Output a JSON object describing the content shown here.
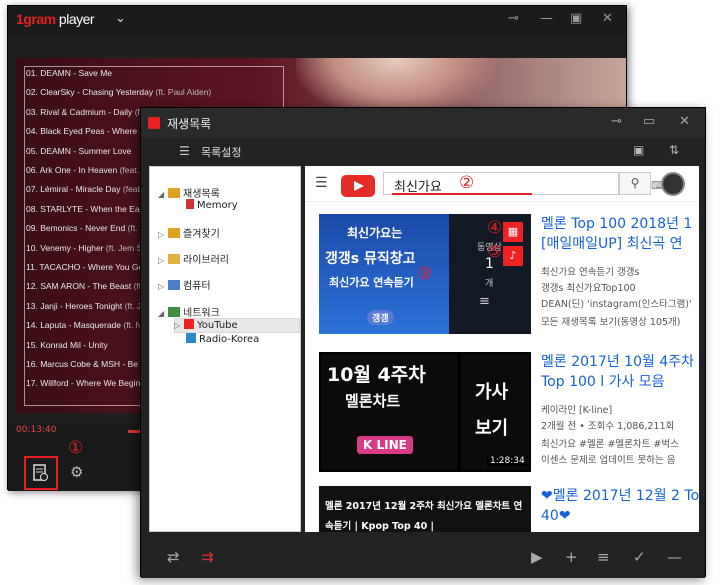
{
  "player": {
    "logo_brand": "1gram",
    "logo_word": "player",
    "time": "00:13:40",
    "tracks": [
      {
        "num": "01.",
        "title": "DEAMN - Save Me",
        "sub": ""
      },
      {
        "num": "02.",
        "title": "ClearSky - Chasing Yesterday",
        "sub": "(ft. Paul Aiden)"
      },
      {
        "num": "03.",
        "title": "Rival & Cadmium - Daily",
        "sub": "(ft. Ja"
      },
      {
        "num": "04.",
        "title": "Black Eyed Peas - Where Is T",
        "sub": ""
      },
      {
        "num": "05.",
        "title": "DEAMN - Summer Love",
        "sub": ""
      },
      {
        "num": "06.",
        "title": "Ark One - In Heaven",
        "sub": "(feat. Y"
      },
      {
        "num": "07.",
        "title": "Lémiral - Miracle Day",
        "sub": "(feat. U"
      },
      {
        "num": "08.",
        "title": "STARLYTE - When the Earth G",
        "sub": ""
      },
      {
        "num": "09.",
        "title": "Bemonics - Never End",
        "sub": "(ft. Ben"
      },
      {
        "num": "10.",
        "title": "Venemy - Higher",
        "sub": "(ft. Jem Str"
      },
      {
        "num": "11.",
        "title": "TACACHO - Where You Go",
        "sub": "(f"
      },
      {
        "num": "12.",
        "title": "SAM ARON - The Beast",
        "sub": "(ft. A"
      },
      {
        "num": "13.",
        "title": "Janji - Heroes Tonight",
        "sub": "(ft. John"
      },
      {
        "num": "14.",
        "title": "Laputa - Masquerade",
        "sub": "(ft. N"
      },
      {
        "num": "15.",
        "title": "Konrad Mil - Unity",
        "sub": ""
      },
      {
        "num": "16.",
        "title": "Marcus Cobe & MSH - Be Free",
        "sub": ""
      },
      {
        "num": "17.",
        "title": "Willford - Where We Begin",
        "sub": "(ft."
      }
    ]
  },
  "callouts": {
    "c1": "①",
    "c2": "②",
    "c3": "③",
    "c4": "④",
    "c5": "⑤"
  },
  "playlist_window": {
    "title": "재생목록",
    "toolbar_label": "목록설정"
  },
  "tree": {
    "items": [
      {
        "label": "재생목록"
      },
      {
        "label": "Memory"
      },
      {
        "label": "즐겨찾기"
      },
      {
        "label": "라이브러리"
      },
      {
        "label": "컴퓨터"
      },
      {
        "label": "네트워크"
      },
      {
        "label": "YouTube"
      },
      {
        "label": "Radio-Korea"
      }
    ]
  },
  "youtube": {
    "search_value": "최신가요",
    "videos": [
      {
        "title": "멜론 Top 100 2018년 1 [매일매일UP] 최신곡 연",
        "thumb_line1": "최신가요는",
        "thumb_line2": "갱갱s 뮤직창고",
        "thumb_line3": "최신가요 연속듣기",
        "thumb_badge": "갱갱",
        "thumb_side1": "동영상",
        "thumb_side2": "1",
        "thumb_side3": "개",
        "meta": [
          "최신가요 연속듣기 갱갱s",
          "갱갱s 최신가요Top100",
          "DEAN(딘) 'instagram(인스타그램)'",
          "모든 재생목록 보기(동영상 105개)"
        ]
      },
      {
        "title": "멜론 2017년 10월 4주차 Top 100 l 가사 모음",
        "thumb_line1": "10월 4주차",
        "thumb_line2": "멜론차트",
        "thumb_logo": "K LINE",
        "thumb_lyric1": "가사",
        "thumb_lyric2": "보기",
        "thumb_duration": "1:28:34",
        "meta": [
          "케이라인 [K-line]",
          "2개월 전 • 조회수 1,086,211회",
          "최신가요 #멜론 #멜론차트 #벅스",
          "이센스 문제로 업데이트 못하는 음"
        ]
      },
      {
        "title": "❤멜론 2017년 12월 2 Top 40❤",
        "thumb_line1": "멜론 2017년 12월 2주차 최신가요 멜론차트 연",
        "thumb_line2": "속듣기 | Kpop Top 40 |",
        "meta": []
      }
    ]
  }
}
